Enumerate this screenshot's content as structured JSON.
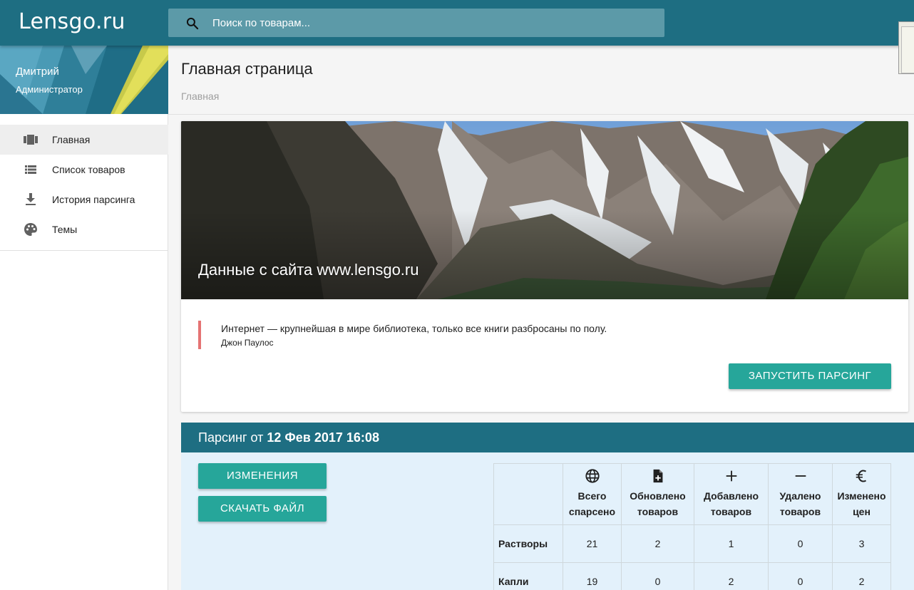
{
  "app": {
    "logo": "Lensgo.ru"
  },
  "search": {
    "placeholder": "Поиск по товарам..."
  },
  "profile": {
    "name": "Дмитрий",
    "role": "Администратор"
  },
  "sidebar": {
    "items": [
      {
        "label": "Главная",
        "icon": "view-carousel-icon",
        "active": true
      },
      {
        "label": "Список товаров",
        "icon": "list-icon",
        "active": false
      },
      {
        "label": "История парсинга",
        "icon": "download-icon",
        "active": false
      },
      {
        "label": "Темы",
        "icon": "palette-icon",
        "active": false
      }
    ]
  },
  "page": {
    "title": "Главная страница",
    "breadcrumb": "Главная"
  },
  "hero": {
    "title": "Данные с сайта www.lensgo.ru",
    "quote": "Интернет — крупнейшая в мире библиотека, только все книги разбросаны по полу.",
    "author": "Джон Паулос",
    "run_button": "Запустить парсинг"
  },
  "parsing": {
    "title_prefix": "Парсинг от",
    "date": "12 Фев 2017 16:08",
    "changes_button": "Изменения",
    "download_button": "Скачать файл",
    "columns": [
      {
        "icon": "globe-icon",
        "line1": "Всего",
        "line2": "спарсено"
      },
      {
        "icon": "note-add-icon",
        "line1": "Обновлено",
        "line2": "товаров"
      },
      {
        "icon": "plus-icon",
        "line1": "Добавлено",
        "line2": "товаров"
      },
      {
        "icon": "minus-icon",
        "line1": "Удалено",
        "line2": "товаров"
      },
      {
        "icon": "euro-icon",
        "line1": "Изменено",
        "line2": "цен"
      }
    ],
    "rows": [
      {
        "label": "Растворы",
        "values": [
          "21",
          "2",
          "1",
          "0",
          "3"
        ]
      },
      {
        "label": "Капли",
        "values": [
          "19",
          "0",
          "2",
          "0",
          "2"
        ]
      }
    ]
  },
  "colors": {
    "primary": "#1e6e82",
    "accent": "#26a69a",
    "quote_border": "#e57373",
    "parse_bg": "#e3f1fb"
  }
}
